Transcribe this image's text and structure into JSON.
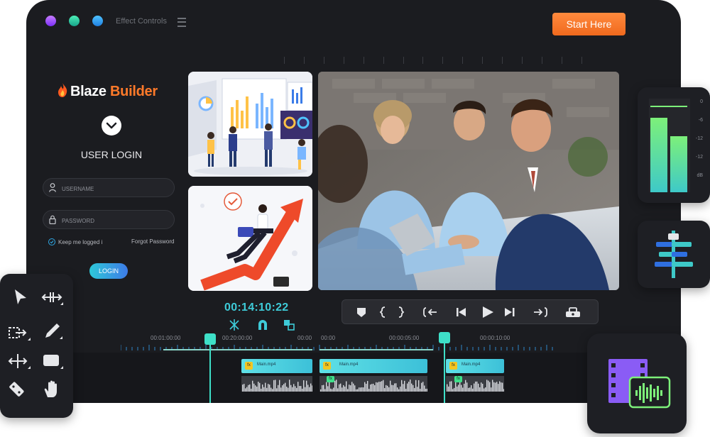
{
  "window": {
    "title": "Effect Controls",
    "start_button": "Start Here"
  },
  "login": {
    "logo_part1": "Blaze",
    "logo_part2": " Builder",
    "heading": "USER LOGIN",
    "username_placeholder": "USERNAME",
    "password_placeholder": "PASSWORD",
    "keep_logged": "Keep me logged i",
    "forgot": "Forgot Password",
    "login_button": "LOGIN"
  },
  "player": {
    "timecode": "00:14:10:22"
  },
  "timeline": {
    "tick_labels": [
      "00:01:00:00",
      "00:20:00:00",
      "00:00",
      "00:00",
      "00:00:05:00",
      "00:00:10:00"
    ],
    "clips": [
      {
        "label": "Main.mp4"
      },
      {
        "label": "Main.mp4"
      },
      {
        "label": "Main.mp4"
      }
    ],
    "fx_label": "fx"
  },
  "meter": {
    "scale": [
      "0",
      "-6",
      "-12",
      "-12",
      "dB"
    ],
    "levels": [
      0.82,
      0.62
    ]
  },
  "colors": {
    "accent_teal": "#3ee0c8",
    "accent_orange": "#f06a1e",
    "window_bg": "#1b1c20"
  },
  "icons": [
    "flame-logo-icon",
    "chevron-down-icon",
    "user-icon",
    "lock-icon",
    "check-icon",
    "marker-icon",
    "bracket-in-out-icon",
    "go-to-in-icon",
    "step-back-icon",
    "play-icon",
    "step-forward-icon",
    "go-to-out-icon",
    "export-frame-icon",
    "split-icon",
    "magnet-icon",
    "link-icon",
    "select-arrow-icon",
    "ripple-trim-icon",
    "track-select-icon",
    "pen-icon",
    "move-icon",
    "rectangle-icon",
    "razor-icon",
    "hand-icon"
  ]
}
